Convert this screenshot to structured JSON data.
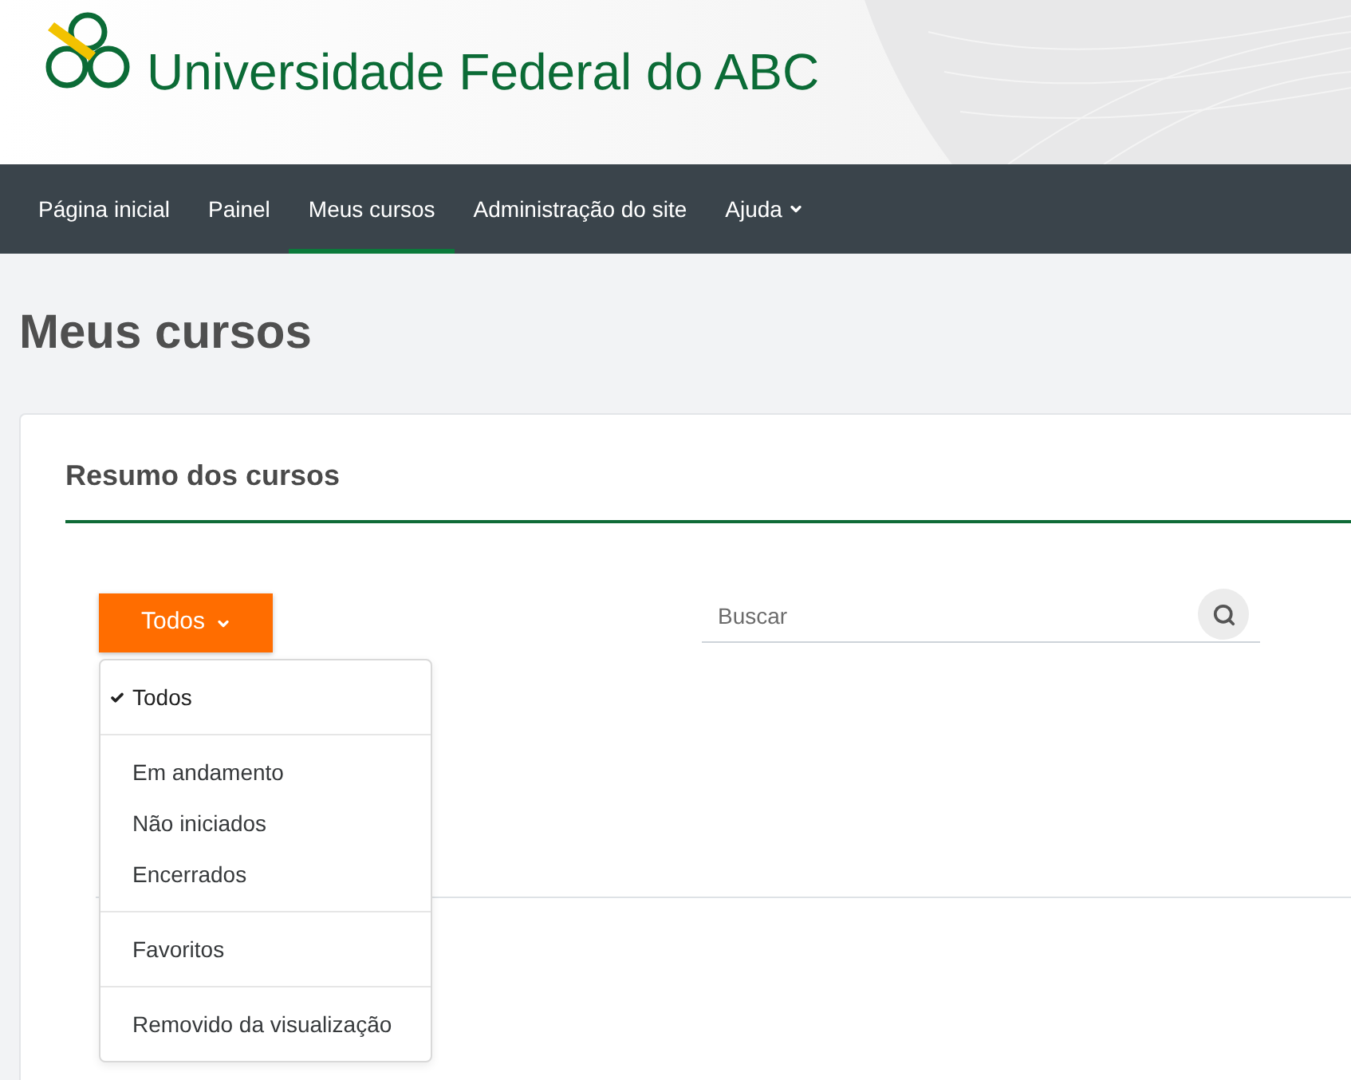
{
  "header": {
    "title": "Universidade Federal do ABC"
  },
  "nav": {
    "items": [
      {
        "label": "Página inicial",
        "selected": false,
        "has_menu": false
      },
      {
        "label": "Painel",
        "selected": false,
        "has_menu": false
      },
      {
        "label": "Meus cursos",
        "selected": true,
        "has_menu": false
      },
      {
        "label": "Administração do site",
        "selected": false,
        "has_menu": false
      },
      {
        "label": "Ajuda",
        "selected": false,
        "has_menu": true
      }
    ]
  },
  "page": {
    "title": "Meus cursos"
  },
  "course_overview": {
    "title": "Resumo dos cursos",
    "filter_button": {
      "label": "Todos",
      "expanded": true
    },
    "search": {
      "placeholder": "Buscar"
    },
    "filter_menu": {
      "groups": [
        {
          "items": [
            {
              "label": "Todos",
              "selected": true
            }
          ]
        },
        {
          "items": [
            {
              "label": "Em andamento",
              "selected": false
            },
            {
              "label": "Não iniciados",
              "selected": false
            },
            {
              "label": "Encerrados",
              "selected": false
            }
          ]
        },
        {
          "items": [
            {
              "label": "Favoritos",
              "selected": false
            }
          ]
        },
        {
          "items": [
            {
              "label": "Removido da visualização",
              "selected": false
            }
          ]
        }
      ]
    }
  }
}
